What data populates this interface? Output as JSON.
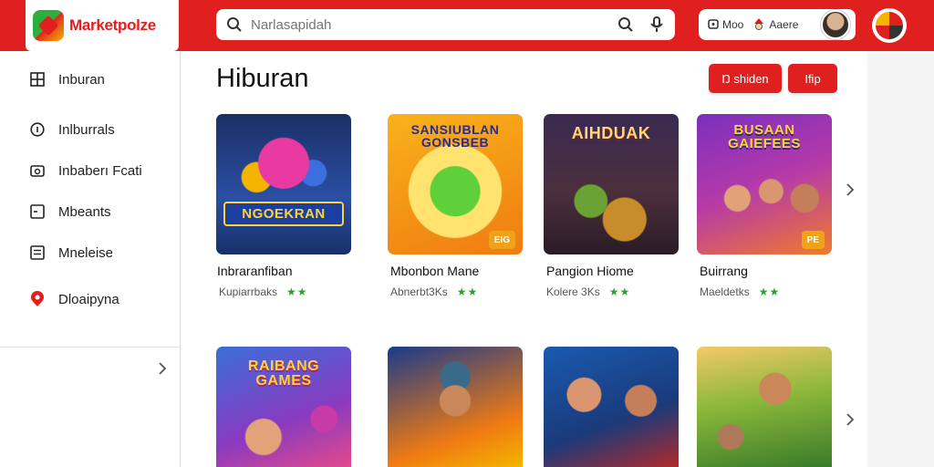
{
  "header": {
    "logo_text": "Marketpolze",
    "search_placeholder": "Narlasapidah",
    "user_item_1": "Moo",
    "user_item_2": "Aaere"
  },
  "sidebar": {
    "items": [
      {
        "label": "Inburan",
        "icon": "grid-icon"
      },
      {
        "label": "Inlburrals",
        "icon": "info-icon"
      },
      {
        "label": "Inbaberı Fcati",
        "icon": "camera-icon"
      },
      {
        "label": "Mbeants",
        "icon": "square-icon"
      },
      {
        "label": "Mneleise",
        "icon": "list-icon"
      },
      {
        "label": "Dloaipyna",
        "icon": "location-pin-icon"
      }
    ]
  },
  "main": {
    "title": "Hiburan",
    "button_primary": "Ŋ shiden",
    "button_secondary": "Ifip"
  },
  "games_row_1": [
    {
      "banner": "NGOEKRAN",
      "badge": "",
      "title": "Inbraranfiban",
      "meta": "Kupiarrbaks"
    },
    {
      "banner": "SANSIUBLAN GONSBEB",
      "badge": "EIG",
      "title": "Mbonbon Mane",
      "meta": "Abnerbt3Ks"
    },
    {
      "banner": "AIHDUAK",
      "badge": "",
      "title": "Pangion Hiome",
      "meta": "Kolere 3Ks"
    },
    {
      "banner": "BUSAAN GAIEFEES",
      "badge": "PE",
      "title": "Buirrang",
      "meta": "Maeldetks"
    }
  ],
  "games_row_2": [
    {
      "banner": "RAIBANG GAMES"
    },
    {
      "banner": ""
    },
    {
      "banner": ""
    },
    {
      "banner": ""
    }
  ],
  "colors": {
    "accent": "#e01f1f",
    "rating": "#2aa32a"
  }
}
